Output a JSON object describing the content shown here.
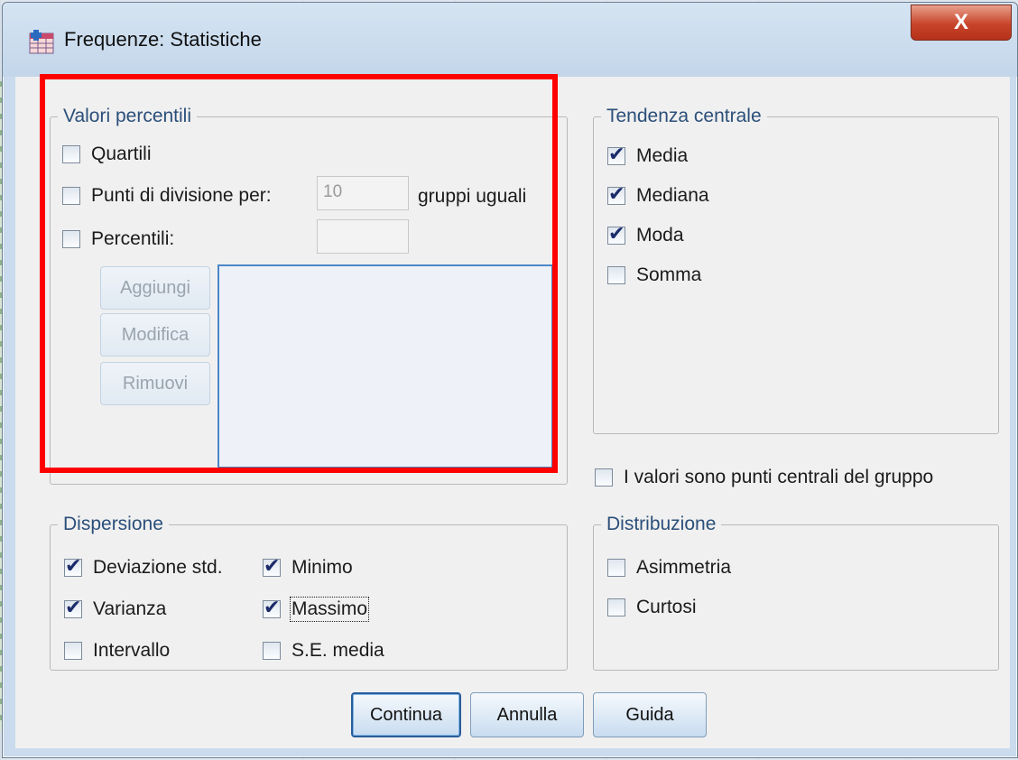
{
  "window": {
    "title": "Frequenze: Statistiche",
    "close_label": "X"
  },
  "percentili": {
    "legend": "Valori percentili",
    "quartili": {
      "label": "Quartili",
      "checked": false
    },
    "punti": {
      "label": "Punti di divisione per:",
      "checked": false,
      "value": "10",
      "suffix": "gruppi uguali"
    },
    "percentili": {
      "label": "Percentili:",
      "checked": false,
      "value": ""
    },
    "buttons": {
      "aggiungi": "Aggiungi",
      "modifica": "Modifica",
      "rimuovi": "Rimuovi"
    }
  },
  "tendenza": {
    "legend": "Tendenza centrale",
    "items": [
      {
        "label": "Media",
        "checked": true
      },
      {
        "label": "Mediana",
        "checked": true
      },
      {
        "label": "Moda",
        "checked": true
      },
      {
        "label": "Somma",
        "checked": false
      }
    ]
  },
  "valori_centrali": {
    "label": "I valori sono punti centrali del gruppo",
    "checked": false
  },
  "dispersione": {
    "legend": "Dispersione",
    "items": [
      {
        "label": "Deviazione std.",
        "checked": true
      },
      {
        "label": "Minimo",
        "checked": true
      },
      {
        "label": "Varianza",
        "checked": true
      },
      {
        "label": "Massimo",
        "checked": true
      },
      {
        "label": "Intervallo",
        "checked": false
      },
      {
        "label": "S.E. media",
        "checked": false
      }
    ]
  },
  "distribuzione": {
    "legend": "Distribuzione",
    "items": [
      {
        "label": "Asimmetria",
        "checked": false
      },
      {
        "label": "Curtosi",
        "checked": false
      }
    ]
  },
  "footer": {
    "continua": "Continua",
    "annulla": "Annulla",
    "guida": "Guida"
  },
  "colors": {
    "highlight": "#ff0000",
    "legend": "#2b4f7a",
    "check": "#1a2b6a"
  }
}
